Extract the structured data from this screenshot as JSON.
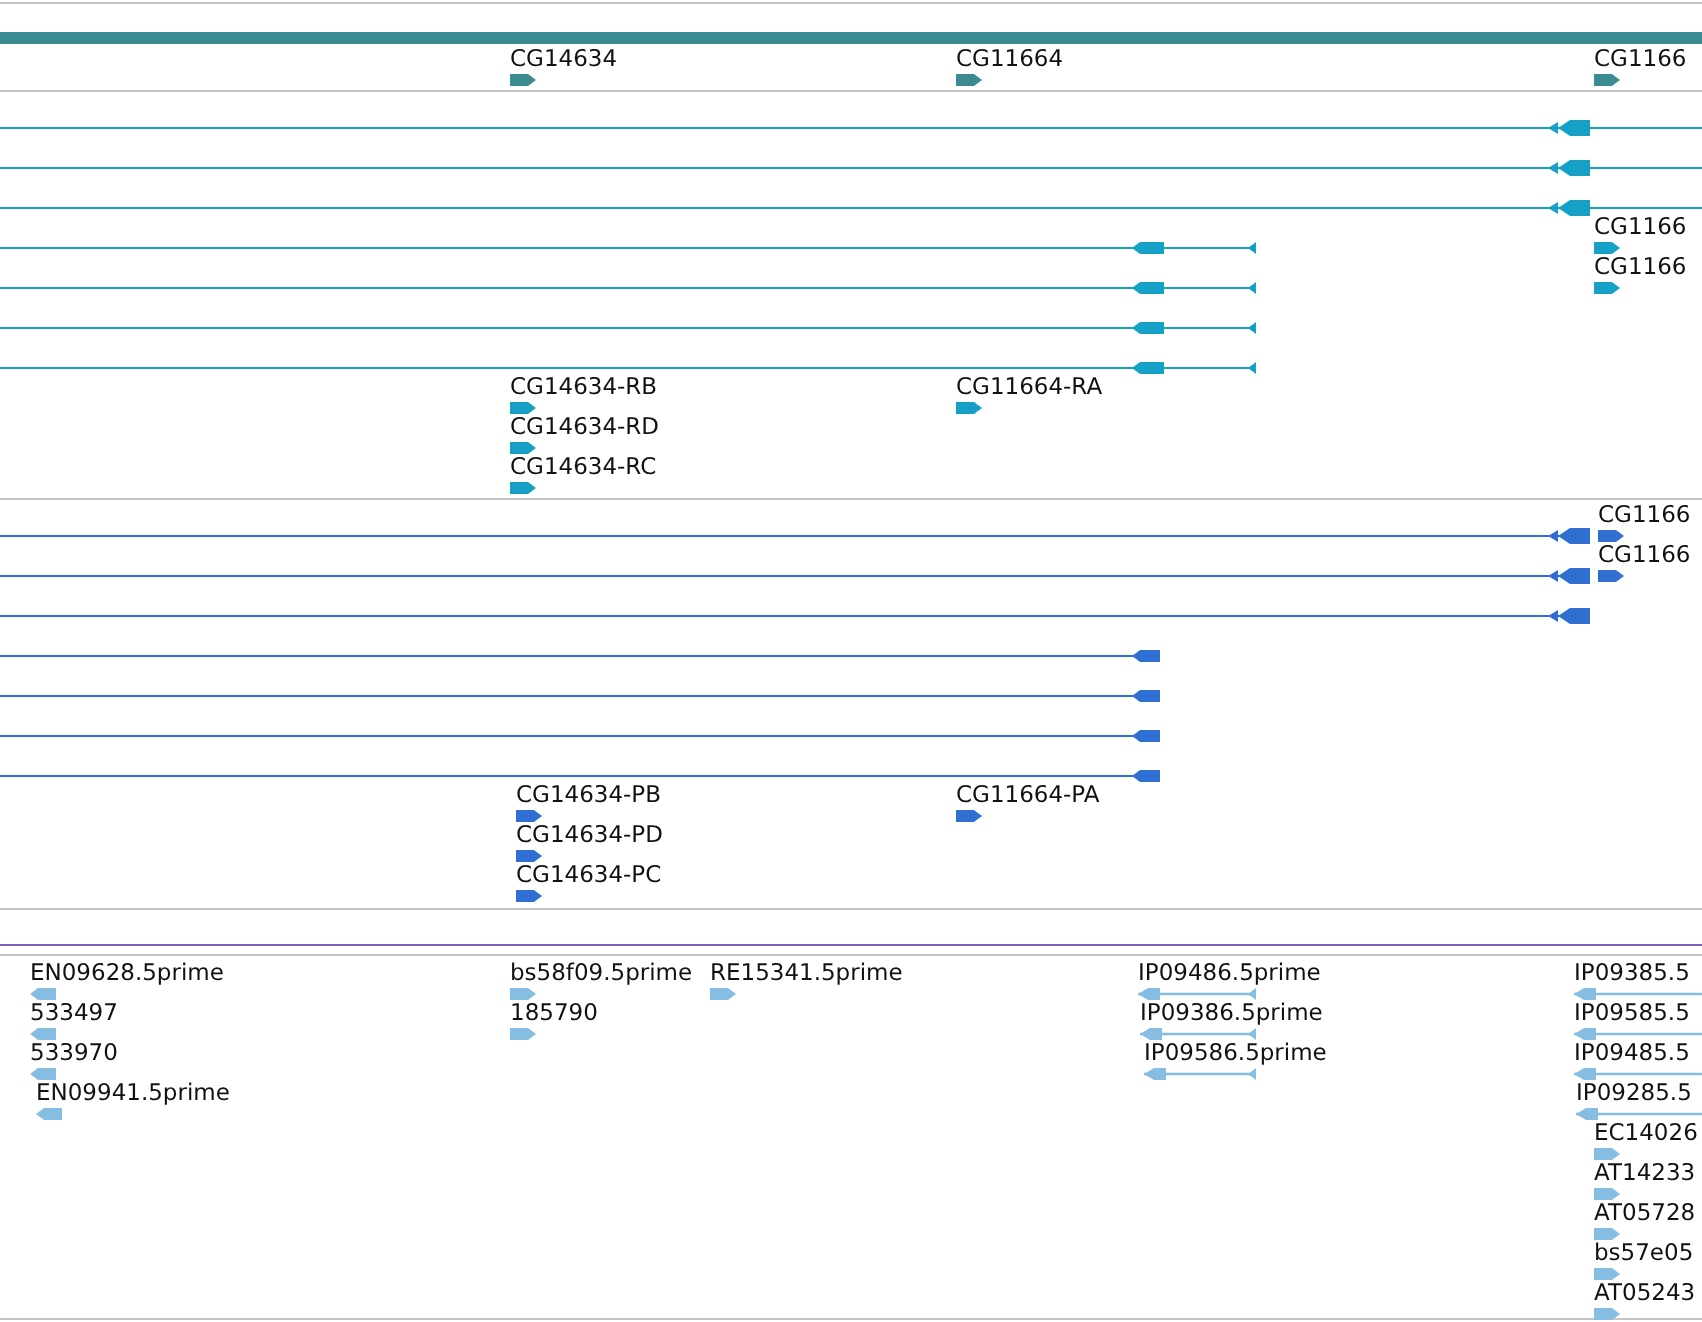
{
  "tracks": [
    {
      "kind": "gene",
      "features": [
        {
          "label": "CG14634",
          "kind": "forward"
        },
        {
          "label": "CG11664",
          "kind": "forward"
        },
        {
          "label": "CG1166",
          "kind": "forward"
        }
      ]
    },
    {
      "kind": "transcript",
      "features": [
        {
          "label": "CG1166",
          "kind": "forward"
        },
        {
          "label": "CG1166",
          "kind": "forward"
        },
        {
          "label": "CG14634-RB",
          "kind": "forward"
        },
        {
          "label": "CG14634-RD",
          "kind": "forward"
        },
        {
          "label": "CG14634-RC",
          "kind": "forward"
        },
        {
          "label": "CG11664-RA",
          "kind": "forward"
        }
      ]
    },
    {
      "kind": "protein",
      "features": [
        {
          "label": "CG1166",
          "kind": "forward"
        },
        {
          "label": "CG1166",
          "kind": "forward"
        },
        {
          "label": "CG14634-PB",
          "kind": "forward"
        },
        {
          "label": "CG14634-PD",
          "kind": "forward"
        },
        {
          "label": "CG14634-PC",
          "kind": "forward"
        },
        {
          "label": "CG11664-PA",
          "kind": "forward"
        }
      ]
    },
    {
      "kind": "est",
      "features": [
        {
          "label": "EN09628.5prime",
          "kind": "reverse"
        },
        {
          "label": "533497",
          "kind": "reverse"
        },
        {
          "label": "533970",
          "kind": "reverse"
        },
        {
          "label": "EN09941.5prime",
          "kind": "reverse"
        },
        {
          "label": "bs58f09.5prime",
          "kind": "forward"
        },
        {
          "label": "185790",
          "kind": "forward"
        },
        {
          "label": "RE15341.5prime",
          "kind": "forward"
        },
        {
          "label": "IP09486.5prime",
          "kind": "paired"
        },
        {
          "label": "IP09386.5prime",
          "kind": "paired"
        },
        {
          "label": "IP09586.5prime",
          "kind": "paired"
        },
        {
          "label": "IP09385.5",
          "kind": "paired"
        },
        {
          "label": "IP09585.5",
          "kind": "paired"
        },
        {
          "label": "IP09485.5",
          "kind": "paired"
        },
        {
          "label": "IP09285.5",
          "kind": "paired"
        },
        {
          "label": "EC14026",
          "kind": "forward"
        },
        {
          "label": "AT14233",
          "kind": "forward"
        },
        {
          "label": "AT05728",
          "kind": "forward"
        },
        {
          "label": "bs57e05",
          "kind": "forward"
        },
        {
          "label": "AT05243",
          "kind": "forward"
        }
      ]
    }
  ]
}
